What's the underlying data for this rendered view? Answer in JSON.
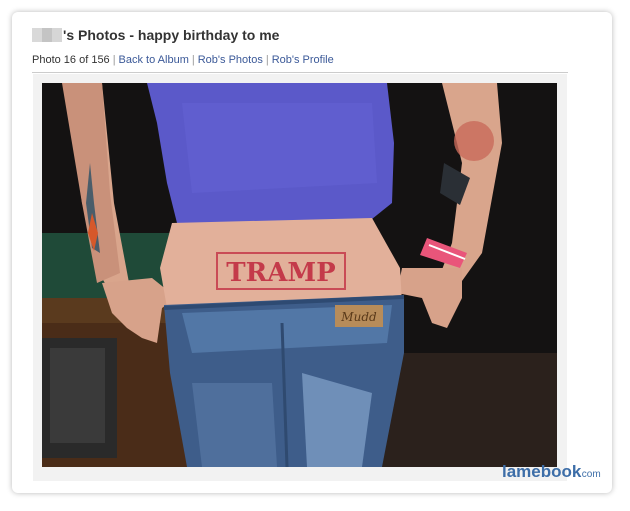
{
  "header": {
    "name_blurred": "",
    "title": "'s Photos - happy birthday to me"
  },
  "subnav": {
    "photo_count": "Photo 16 of 156",
    "back_to_album": "Back to Album",
    "robs_photos": "Rob's Photos",
    "robs_profile": "Rob's Profile"
  },
  "photo": {
    "tattoo_text": "TRAMP",
    "label_text": "Mudd"
  },
  "watermark": {
    "brand": "lamebook",
    "suffix": ".com"
  }
}
